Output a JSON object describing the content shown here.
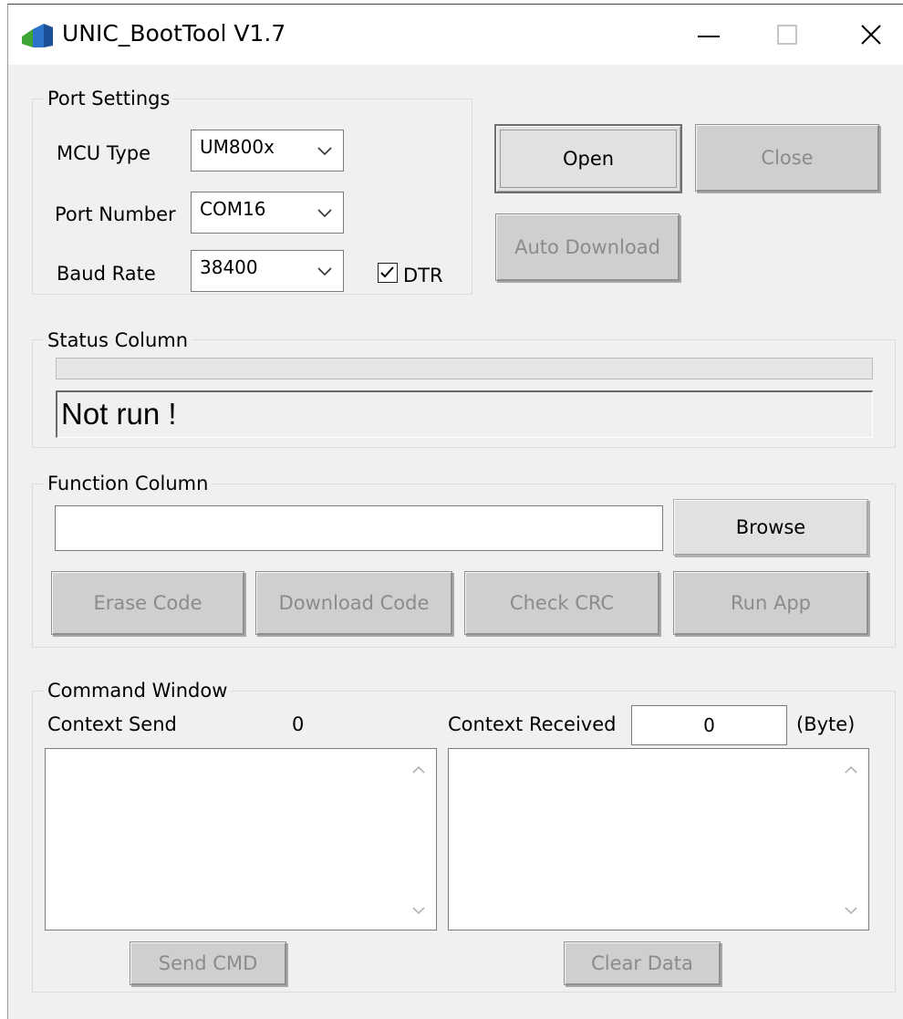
{
  "window": {
    "title": "UNIC_BootTool V1.7"
  },
  "port_settings": {
    "legend": "Port Settings",
    "mcu_type_label": "MCU Type",
    "mcu_type_value": "UM800x",
    "port_number_label": "Port Number",
    "port_number_value": "COM16",
    "baud_rate_label": "Baud Rate",
    "baud_rate_value": "38400",
    "dtr_label": "DTR",
    "dtr_checked": true
  },
  "port_buttons": {
    "open": "Open",
    "close": "Close",
    "auto_download": "Auto Download"
  },
  "status": {
    "legend": "Status Column",
    "progress": 0,
    "message": "Not run !"
  },
  "function": {
    "legend": "Function Column",
    "file_path": "",
    "browse": "Browse",
    "erase_code": "Erase Code",
    "download_code": "Download Code",
    "check_crc": "Check CRC",
    "run_app": "Run App"
  },
  "command": {
    "legend": "Command Window",
    "send_label": "Context Send",
    "send_count": "0",
    "received_label": "Context Received",
    "received_count": "0",
    "unit": "(Byte)",
    "send_cmd": "Send CMD",
    "clear_data": "Clear Data"
  },
  "colors": {
    "accent_icon_blue": "#2b74c9",
    "accent_icon_green": "#3fa535"
  }
}
